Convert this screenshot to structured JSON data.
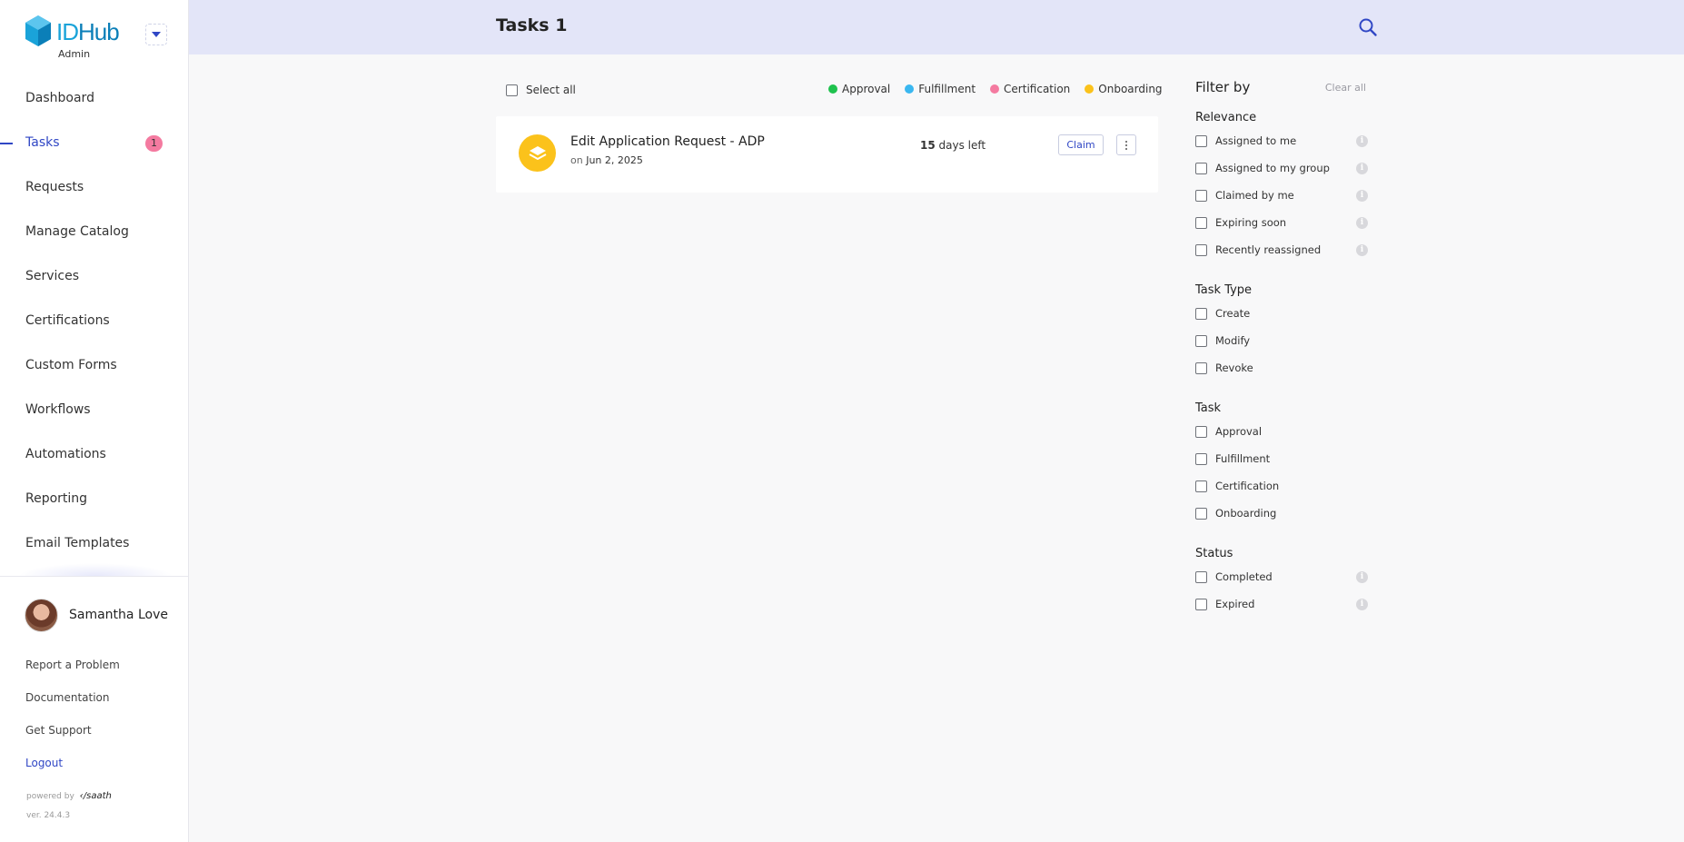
{
  "app": {
    "logo_text_1": "ID",
    "logo_text_2": "Hub",
    "logo_subtitle": "Admin"
  },
  "sidebar": {
    "items": [
      {
        "label": "Dashboard"
      },
      {
        "label": "Tasks",
        "badge": "1",
        "active": true
      },
      {
        "label": "Requests"
      },
      {
        "label": "Manage Catalog"
      },
      {
        "label": "Services"
      },
      {
        "label": "Certifications"
      },
      {
        "label": "Custom Forms"
      },
      {
        "label": "Workflows"
      },
      {
        "label": "Automations"
      },
      {
        "label": "Reporting"
      },
      {
        "label": "Email Templates"
      }
    ],
    "user_name": "Samantha Love",
    "links": [
      "Report a Problem",
      "Documentation",
      "Get Support",
      "Logout"
    ],
    "powered_by": "powered by",
    "powered_brand": "‹/saath",
    "version": "ver. 24.4.3"
  },
  "header": {
    "title": "Tasks 1"
  },
  "main": {
    "select_all_label": "Select all",
    "legend": [
      {
        "label": "Approval",
        "color": "#1fc24e"
      },
      {
        "label": "Fulfillment",
        "color": "#3ab7f0"
      },
      {
        "label": "Certification",
        "color": "#f47aa0"
      },
      {
        "label": "Onboarding",
        "color": "#fbc21b"
      }
    ],
    "task": {
      "title": "Edit Application Request - ADP",
      "date_prefix": "on",
      "date": "Jun 2, 2025",
      "days_number": "15",
      "days_suffix": "days left",
      "claim_label": "Claim",
      "icon": "layers-icon",
      "icon_color": "#fbc21b"
    }
  },
  "filter": {
    "title": "Filter by",
    "clear_all": "Clear all",
    "sections": [
      {
        "title": "Relevance",
        "options": [
          {
            "label": "Assigned to me",
            "info": true
          },
          {
            "label": "Assigned to my group",
            "info": true
          },
          {
            "label": "Claimed by me",
            "info": true
          },
          {
            "label": "Expiring soon",
            "info": true
          },
          {
            "label": "Recently reassigned",
            "info": true
          }
        ]
      },
      {
        "title": "Task Type",
        "options": [
          {
            "label": "Create",
            "info": false
          },
          {
            "label": "Modify",
            "info": false
          },
          {
            "label": "Revoke",
            "info": false
          }
        ]
      },
      {
        "title": "Task",
        "options": [
          {
            "label": "Approval",
            "info": false
          },
          {
            "label": "Fulfillment",
            "info": false
          },
          {
            "label": "Certification",
            "info": false
          },
          {
            "label": "Onboarding",
            "info": false
          }
        ]
      },
      {
        "title": "Status",
        "options": [
          {
            "label": "Completed",
            "info": true
          },
          {
            "label": "Expired",
            "info": true
          }
        ]
      }
    ]
  },
  "colors": {
    "accent": "#3047c5",
    "topbar": "#e3e5f8",
    "badge": "#f47aa0"
  }
}
